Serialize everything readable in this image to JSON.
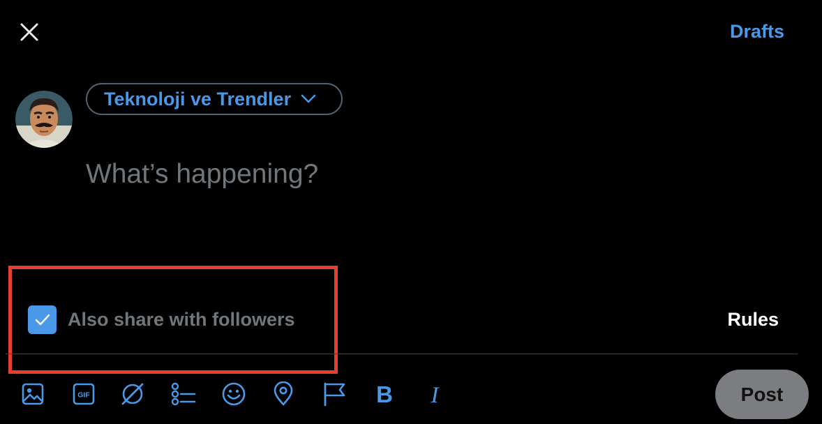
{
  "header": {
    "close_icon": "close-icon",
    "drafts_label": "Drafts"
  },
  "composer": {
    "avatar_icon": "user-avatar",
    "audience_label": "Teknoloji ve Trendler",
    "audience_chevron_icon": "chevron-down-icon",
    "placeholder": "What’s happening?",
    "value": ""
  },
  "share": {
    "checked": true,
    "label": "Also share with followers",
    "rules_label": "Rules"
  },
  "toolbar": {
    "items": [
      {
        "name": "media-icon"
      },
      {
        "name": "gif-icon",
        "text": "GIF"
      },
      {
        "name": "grok-icon"
      },
      {
        "name": "poll-icon"
      },
      {
        "name": "emoji-icon"
      },
      {
        "name": "location-icon"
      },
      {
        "name": "flag-icon"
      },
      {
        "name": "bold-icon",
        "text": "B"
      },
      {
        "name": "italic-icon",
        "text": "I"
      }
    ],
    "post_label": "Post"
  },
  "colors": {
    "accent": "#4a99e9",
    "background": "#000000",
    "muted_text": "#71767b",
    "highlight": "#e5402f",
    "post_button_disabled": "#7b7d80"
  }
}
